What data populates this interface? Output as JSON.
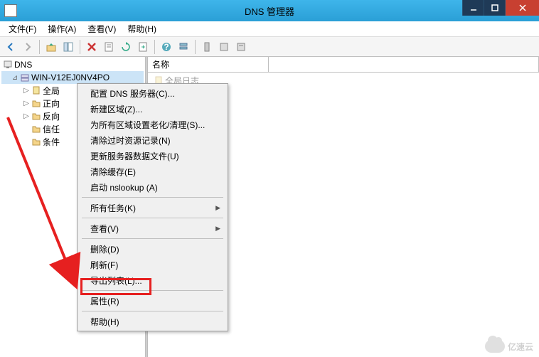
{
  "window": {
    "title": "DNS 管理器"
  },
  "menubar": {
    "file": "文件(F)",
    "action": "操作(A)",
    "view": "查看(V)",
    "help": "帮助(H)"
  },
  "tree": {
    "root": "DNS",
    "server": "WIN-V12EJ0NV4PO",
    "nodes": {
      "global": "全局",
      "forward": "正向",
      "reverse": "反向",
      "trust": "信任",
      "cond": "条件"
    }
  },
  "listview": {
    "column_name": "名称",
    "row_global_log": "全局日志"
  },
  "context_menu": {
    "configure_dns": "配置 DNS 服务器(C)...",
    "new_zone": "新建区域(Z)...",
    "set_aging": "为所有区域设置老化/清理(S)...",
    "clear_stale": "清除过时资源记录(N)",
    "update_files": "更新服务器数据文件(U)",
    "clear_cache": "清除缓存(E)",
    "launch_nslookup": "启动 nslookup (A)",
    "all_tasks": "所有任务(K)",
    "view": "查看(V)",
    "delete": "删除(D)",
    "refresh": "刷新(F)",
    "export_list": "导出列表(L)...",
    "properties": "属性(R)",
    "help": "帮助(H)"
  },
  "watermark": "亿速云",
  "annotation": {
    "highlighted_item": "properties",
    "arrow_points_to": "properties"
  }
}
